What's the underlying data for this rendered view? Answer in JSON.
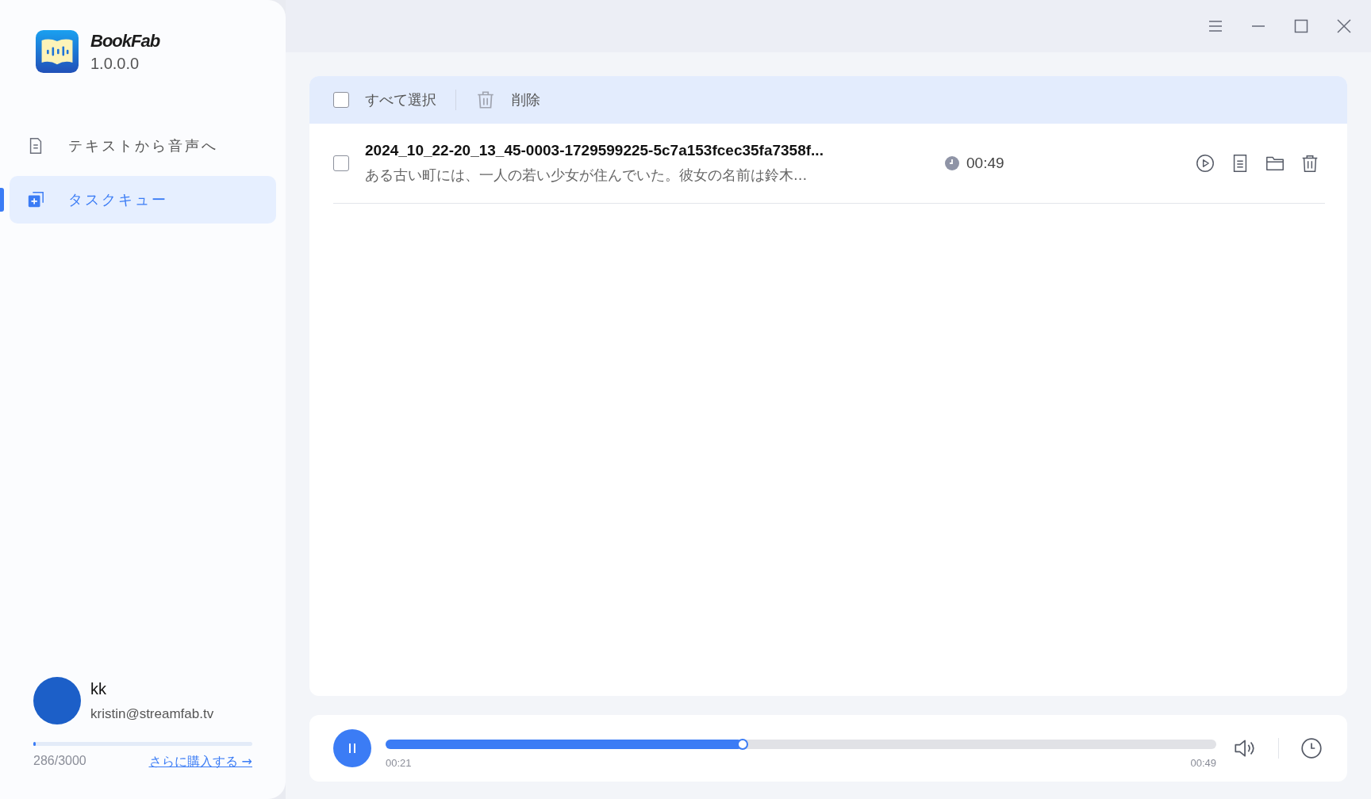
{
  "app": {
    "name": "BookFab",
    "version": "1.0.0.0"
  },
  "sidebar": {
    "items": [
      {
        "label": "テキストから音声へ",
        "kind": "document",
        "selected": false
      },
      {
        "label": "タスクキュー",
        "kind": "queue",
        "selected": true
      }
    ]
  },
  "user": {
    "name": "kk",
    "email": "kristin@streamfab.tv",
    "quota": "286/3000",
    "level": 0.01,
    "buy_link": "さらに購入する →"
  },
  "toolbar": {
    "select_all": {
      "label": "すべて選択",
      "checked": false
    },
    "delete": "削除"
  },
  "tasks": [
    {
      "checked": false,
      "title": "2024_10_22-20_13_45-0003-1729599225-5c7a153fcec35fa7358f...",
      "preview": "ある古い町には、一人の若い少女が住んでいた。彼女の名前は鈴木...",
      "duration": "00:49"
    }
  ],
  "player": {
    "playing": true,
    "level": 0.43,
    "current": "00:21",
    "total": "00:49"
  }
}
